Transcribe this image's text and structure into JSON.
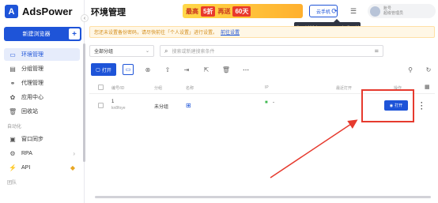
{
  "app": {
    "name": "AdsPower",
    "logo_letter": "A"
  },
  "sidebar": {
    "new_browser_label": "新建浏览器",
    "plus": "+",
    "items": [
      {
        "label": "环境管理",
        "icon": "browser-window-icon",
        "glyph": "▭",
        "active": true
      },
      {
        "label": "分组管理",
        "icon": "folder-icon",
        "glyph": "▤"
      },
      {
        "label": "代理管理",
        "icon": "proxy-icon",
        "glyph": "⚭"
      },
      {
        "label": "应用中心",
        "icon": "apps-icon",
        "glyph": "✿"
      },
      {
        "label": "回收站",
        "icon": "trash-icon",
        "glyph": "🗑"
      }
    ],
    "section_automation": "自动化",
    "automation_items": [
      {
        "label": "窗口同步",
        "icon": "sync-window-icon",
        "glyph": "▣"
      },
      {
        "label": "RPA",
        "icon": "rpa-robot-icon",
        "glyph": "⚙",
        "arrow": "›"
      },
      {
        "label": "API",
        "icon": "api-icon",
        "glyph": "⚡",
        "badge": "◆"
      }
    ],
    "section_team": "团队",
    "collapse": "‹"
  },
  "header": {
    "title": "环境管理",
    "promo": {
      "part1": "最高",
      "discount": "5折",
      "part2": "再送",
      "days": "60天"
    },
    "cloud_phone": "云手机",
    "tooltip": "发现新版本v2.7.5.2，查看更新",
    "user_line1": "账号",
    "user_line2": "超级管理员"
  },
  "notice": {
    "text": "您还未设置备份密码，请尽快前往「个人设置」进行设置。",
    "link": "前往设置"
  },
  "filters": {
    "group": "全部分组",
    "search_placeholder": "搜索或新建搜索条件"
  },
  "toolbar": {
    "open": "打开"
  },
  "table": {
    "headers": [
      "编号/ID",
      "分组",
      "名称",
      "IP",
      "最近打开",
      "操作"
    ],
    "rows": [
      {
        "number": "1",
        "id": "kn8foye",
        "group": "未分组",
        "platform": "windows",
        "ip": "-",
        "open": "打开"
      }
    ]
  },
  "colors": {
    "primary": "#1e54d8",
    "highlight": "#e63a2e"
  }
}
